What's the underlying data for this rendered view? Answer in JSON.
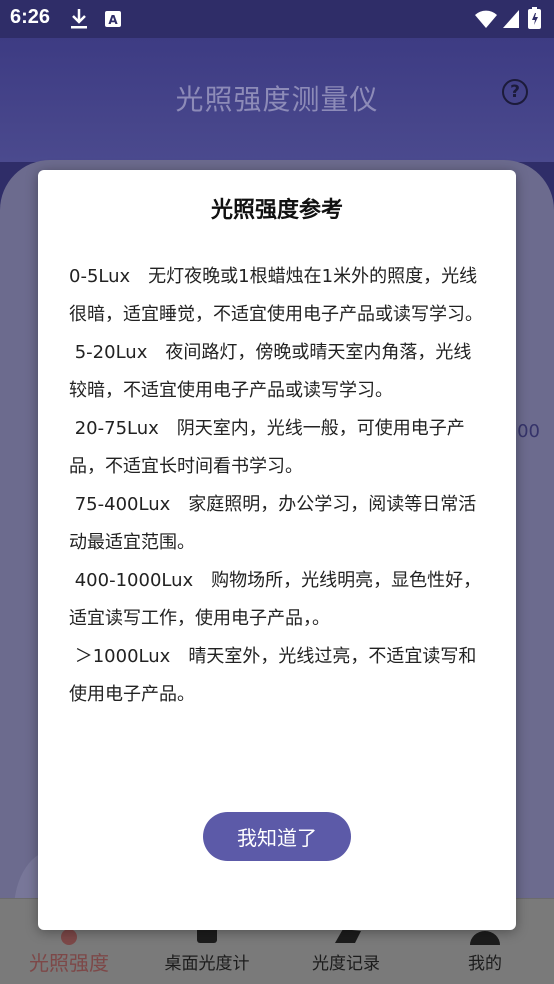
{
  "status_bar": {
    "time": "6:26",
    "icons": [
      "download-icon",
      "font-icon",
      "wifi-icon",
      "signal-icon",
      "battery-icon"
    ]
  },
  "app": {
    "title": "光照强度测量仪",
    "peek_value": "00"
  },
  "bottom_nav": {
    "items": [
      {
        "label": "光照强度",
        "icon": "sun-icon",
        "active": true
      },
      {
        "label": "桌面光度计",
        "icon": "lamp-icon",
        "active": false
      },
      {
        "label": "光度记录",
        "icon": "record-icon",
        "active": false
      },
      {
        "label": "我的",
        "icon": "user-icon",
        "active": false
      }
    ]
  },
  "dialog": {
    "title": "光照强度参考",
    "entries": [
      "0-5Lux　无灯夜晚或1根蜡烛在1米外的照度，光线很暗，适宜睡觉，不适宜使用电子产品或读写学习。",
      " 5-20Lux　夜间路灯，傍晚或晴天室内角落，光线较暗，不适宜使用电子产品或读写学习。",
      " 20-75Lux　阴天室内，光线一般，可使用电子产品，不适宜长时间看书学习。",
      " 75-400Lux　家庭照明，办公学习，阅读等日常活动最适宜范围。",
      " 400-1000Lux　购物场所，光线明亮，显色性好，适宜读写工作，使用电子产品，。",
      " ＞1000Lux　晴天室外，光线过亮，不适宜读写和使用电子产品。"
    ],
    "confirm_label": "我知道了"
  },
  "colors": {
    "header": "#3d3b83",
    "accent": "#5c5aa8",
    "active_nav": "#7d4848"
  }
}
